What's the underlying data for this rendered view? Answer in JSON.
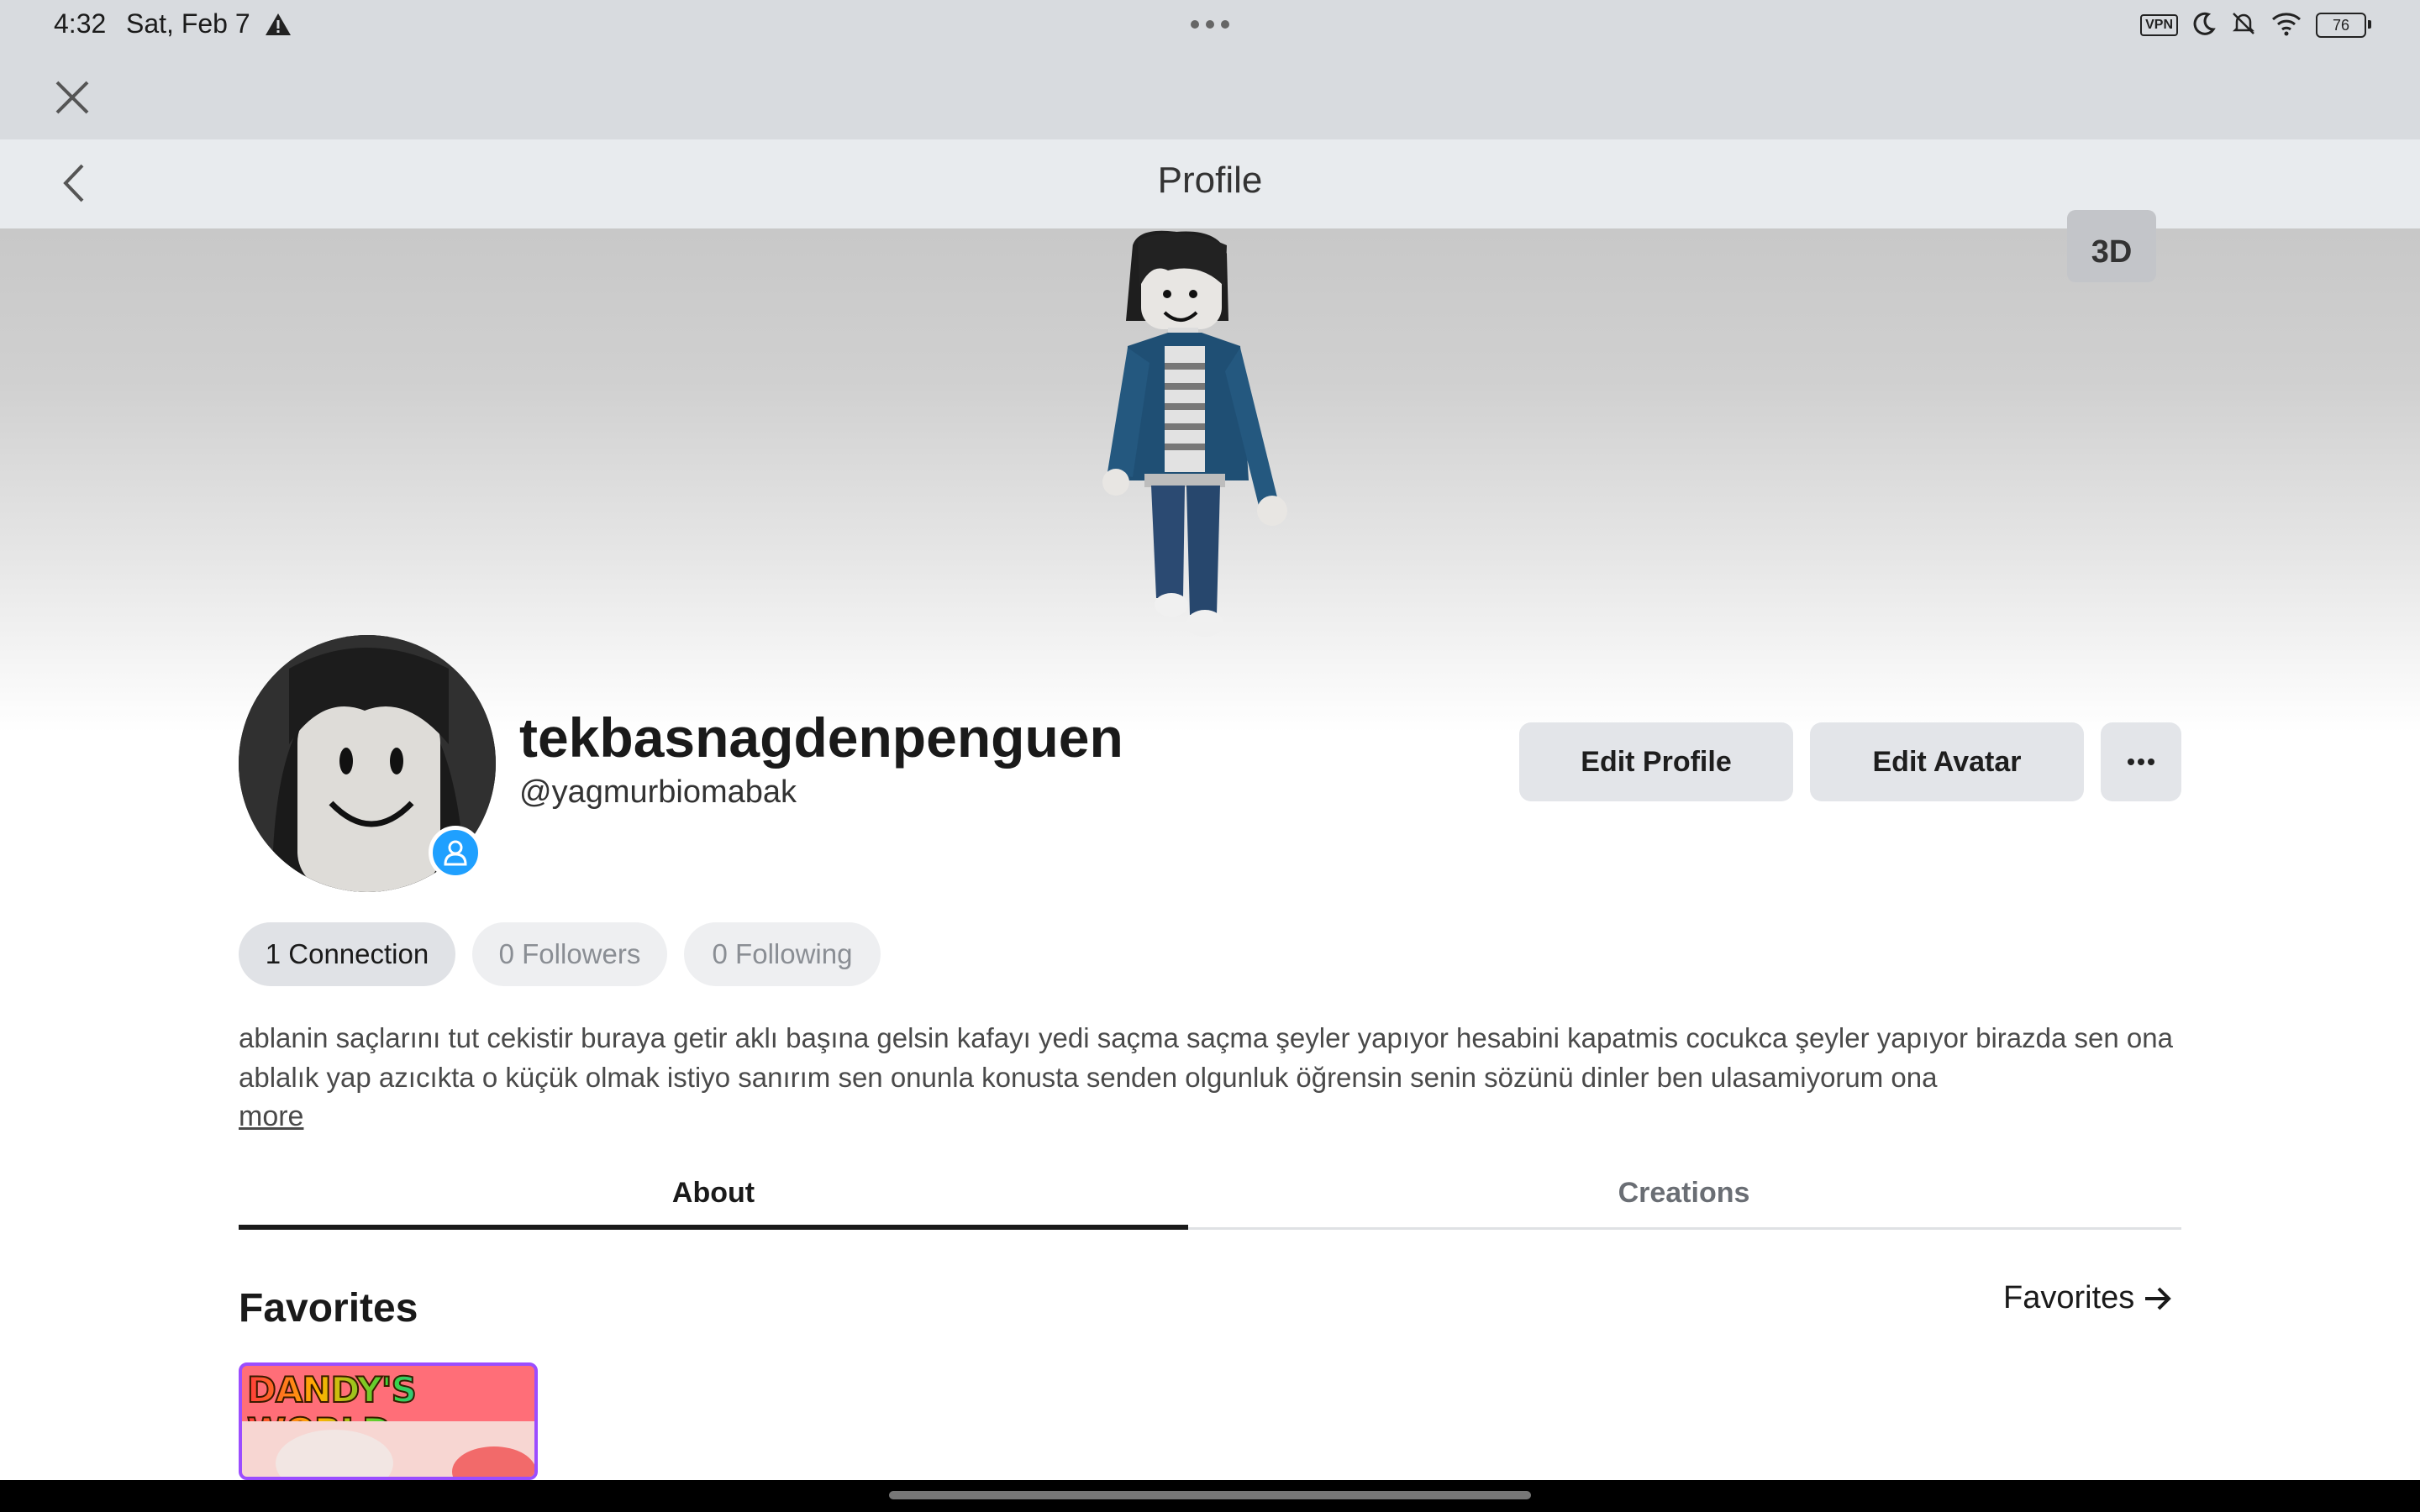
{
  "status_bar": {
    "time": "4:32",
    "date": "Sat, Feb 7",
    "battery": "76",
    "vpn_label": "VPN",
    "icons": [
      "warning-icon",
      "vpn-icon",
      "moon-icon",
      "bell-off-icon",
      "wifi-icon",
      "battery-icon"
    ]
  },
  "header": {
    "title": "Profile"
  },
  "hero": {
    "view_toggle": "3D"
  },
  "profile": {
    "display_name": "tekbasnagdenpenguen",
    "username": "@yagmurbiomabak",
    "buttons": {
      "edit_profile": "Edit Profile",
      "edit_avatar": "Edit Avatar",
      "more": "···"
    },
    "stats": {
      "connections": "1 Connection",
      "followers": "0 Followers",
      "following": "0 Following"
    },
    "bio": "ablanin saçlarını tut cekistir buraya getir aklı başına gelsin kafayı yedi saçma saçma şeyler yapıyor hesabini kapatmis cocukca şeyler yapıyor birazda sen ona ablalık yap azıcıkta o küçük olmak istiyo sanırım sen onunla konusta senden olgunluk öğrensin senin sözünü dinler ben ulasamiyorum ona",
    "more_link": "more"
  },
  "tabs": [
    {
      "label": "About",
      "active": true
    },
    {
      "label": "Creations",
      "active": false
    }
  ],
  "favorites": {
    "title": "Favorites",
    "link": "Favorites",
    "items": [
      {
        "title": "DANDY'S WORLD"
      }
    ]
  },
  "colors": {
    "online_badge": "#1fa0ff",
    "button_bg": "#e3e5e9",
    "header_bg": "#e8ebee",
    "status_bg": "#d8dbdf"
  }
}
